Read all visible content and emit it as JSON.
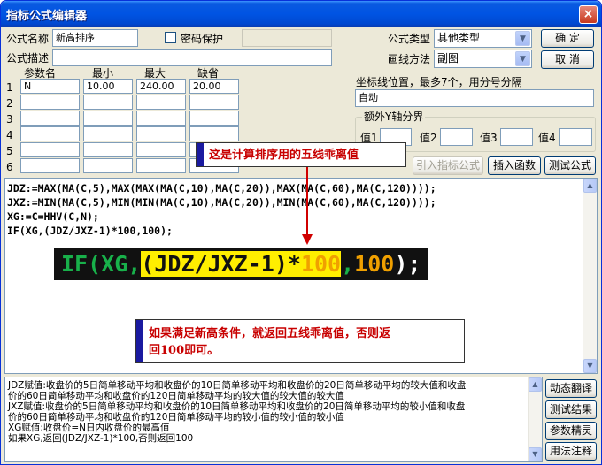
{
  "window": {
    "title": "指标公式编辑器",
    "close": "×"
  },
  "form": {
    "name_label": "公式名称",
    "name_value": "新高排序",
    "password_label": "密码保护",
    "desc_label": "公式描述",
    "type_label": "公式类型",
    "type_value": "其他类型",
    "draw_label": "画线方法",
    "draw_value": "副图"
  },
  "buttons": {
    "ok": "确  定",
    "cancel": "取  消",
    "import": "引入指标公式",
    "insert_fn": "插入函数",
    "test": "测试公式"
  },
  "params": {
    "headers": [
      "参数名",
      "最小",
      "最大",
      "缺省"
    ],
    "rows": [
      {
        "num": "1",
        "name": "N",
        "min": "10.00",
        "max": "240.00",
        "def": "20.00"
      },
      {
        "num": "2",
        "name": "",
        "min": "",
        "max": "",
        "def": ""
      },
      {
        "num": "3",
        "name": "",
        "min": "",
        "max": "",
        "def": ""
      },
      {
        "num": "4",
        "name": "",
        "min": "",
        "max": "",
        "def": ""
      },
      {
        "num": "5",
        "name": "",
        "min": "",
        "max": "",
        "def": ""
      },
      {
        "num": "6",
        "name": "",
        "min": "",
        "max": "",
        "def": ""
      }
    ]
  },
  "axis": {
    "label": "坐标线位置，最多7个，用分号分隔",
    "value": "自动",
    "group_label": "额外Y轴分界",
    "v1": "值1",
    "v2": "值2",
    "v3": "值3",
    "v4": "值4"
  },
  "code_lines": [
    "JDZ:=MAX(MA(C,5),MAX(MAX(MA(C,10),MA(C,20)),MAX(MA(C,60),MA(C,120))));",
    "JXZ:=MIN(MA(C,5),MIN(MIN(MA(C,10),MA(C,20)),MIN(MA(C,60),MA(C,120))));",
    "XG:=C=HHV(C,N);",
    "IF(XG,(JDZ/JXZ-1)*100,100);"
  ],
  "zoom": {
    "pre": "IF(XG,",
    "hl_a": "(JDZ/JXZ-1)*",
    "hl_num": "100",
    "mid": ",",
    "num": "100",
    "post": ");"
  },
  "callouts": {
    "top": "这是计算排序用的五线乖离值",
    "bottom_line1": "如果满足新高条件，就返回五线乖离值，否则返",
    "bottom_line2": "回100即可。"
  },
  "notes": [
    "JDZ赋值:收盘价的5日简单移动平均和收盘价的10日简单移动平均和收盘价的20日简单移动平均的较大值和收盘",
    "价的60日简单移动平均和收盘价的120日简单移动平均的较大值的较大值的较大值",
    "JXZ赋值:收盘价的5日简单移动平均和收盘价的10日简单移动平均和收盘价的20日简单移动平均的较小值和收盘",
    "价的60日简单移动平均和收盘价的120日简单移动平均的较小值的较小值的较小值",
    "XG赋值:收盘价=N日内收盘价的最高值",
    "如果XG,返回(JDZ/JXZ-1)*100,否则返回100"
  ],
  "side_buttons": [
    "动态翻译",
    "测试结果",
    "参数精灵",
    "用法注释"
  ],
  "colors": {
    "title_bar": "#0054e3",
    "callout_text": "#c80000",
    "highlight": "#ffee00"
  }
}
